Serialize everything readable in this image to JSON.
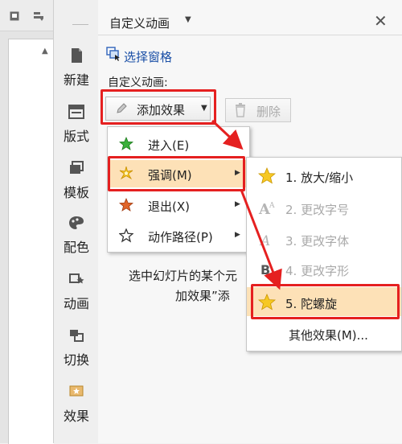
{
  "panel": {
    "title": "自定义动画",
    "select_pane": "选择窗格",
    "custom_label": "自定义动画:",
    "add_effect": "添加效果",
    "delete": "删除",
    "help_line1": "选中幻灯片的某个元",
    "help_line2": "加效果”添"
  },
  "toolbar": {
    "items": [
      {
        "label": "新建",
        "icon": "new-file-icon"
      },
      {
        "label": "版式",
        "icon": "layout-icon"
      },
      {
        "label": "模板",
        "icon": "template-icon"
      },
      {
        "label": "配色",
        "icon": "palette-icon"
      },
      {
        "label": "动画",
        "icon": "animation-icon"
      },
      {
        "label": "切换",
        "icon": "transition-icon"
      },
      {
        "label": "效果",
        "icon": "effect-icon"
      }
    ]
  },
  "menu": {
    "items": [
      {
        "label": "进入(E)",
        "icon": "green-star-icon"
      },
      {
        "label": "强调(M)",
        "icon": "sparkle-star-icon"
      },
      {
        "label": "退出(X)",
        "icon": "red-star-icon"
      },
      {
        "label": "动作路径(P)",
        "icon": "outline-star-icon"
      }
    ]
  },
  "submenu": {
    "items": [
      {
        "label": "1. 放大/缩小",
        "disabled": false
      },
      {
        "label": "2. 更改字号",
        "disabled": true
      },
      {
        "label": "3. 更改字体",
        "disabled": true
      },
      {
        "label": "4. 更改字形",
        "disabled": true
      },
      {
        "label": "5. 陀螺旋",
        "disabled": false
      }
    ],
    "more": "其他效果(M)..."
  },
  "colors": {
    "highlight_red": "#e52020",
    "menu_hover": "#fde1b7",
    "link_blue": "#1a4fa6"
  }
}
